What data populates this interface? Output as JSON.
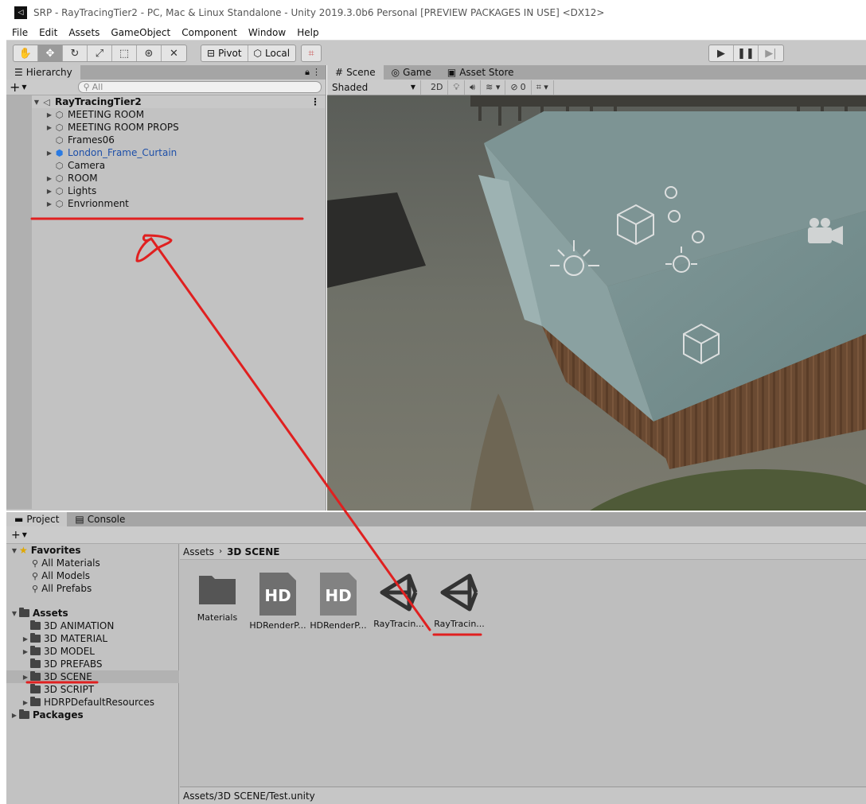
{
  "window": {
    "title": "SRP - RayTracingTier2 - PC, Mac & Linux Standalone - Unity 2019.3.0b6 Personal [PREVIEW PACKAGES IN USE] <DX12>"
  },
  "menu": [
    "File",
    "Edit",
    "Assets",
    "GameObject",
    "Component",
    "Window",
    "Help"
  ],
  "toolbar": {
    "pivot_label": "Pivot",
    "local_label": "Local"
  },
  "hierarchy": {
    "tab_label": "Hierarchy",
    "search_placeholder": "All",
    "root": "RayTracingTier2",
    "items": [
      {
        "label": "MEETING ROOM",
        "expandable": true
      },
      {
        "label": "MEETING ROOM PROPS",
        "expandable": true
      },
      {
        "label": "Frames06",
        "expandable": false
      },
      {
        "label": "London_Frame_Curtain",
        "expandable": true,
        "prefab": true
      },
      {
        "label": "Camera",
        "expandable": false
      },
      {
        "label": "ROOM",
        "expandable": true
      },
      {
        "label": "Lights",
        "expandable": true
      },
      {
        "label": "Envrionment",
        "expandable": true
      }
    ]
  },
  "scene": {
    "tabs": [
      "Scene",
      "Game",
      "Asset Store"
    ],
    "draw_mode": "Shaded",
    "mode_2d": "2D",
    "hidden_count": "0"
  },
  "project": {
    "tabs": [
      "Project",
      "Console"
    ],
    "favorites_label": "Favorites",
    "favorites": [
      "All Materials",
      "All Models",
      "All Prefabs"
    ],
    "assets_label": "Assets",
    "folders": [
      {
        "label": "3D ANIMATION",
        "expandable": false
      },
      {
        "label": "3D MATERIAL",
        "expandable": true
      },
      {
        "label": "3D MODEL",
        "expandable": true
      },
      {
        "label": "3D PREFABS",
        "expandable": false
      },
      {
        "label": "3D SCENE",
        "expandable": true,
        "selected": true
      },
      {
        "label": "3D SCRIPT",
        "expandable": false
      },
      {
        "label": "HDRPDefaultResources",
        "expandable": true
      }
    ],
    "packages_label": "Packages",
    "breadcrumb": {
      "root": "Assets",
      "current": "3D SCENE"
    },
    "asset_items": [
      {
        "label": "Materials",
        "icon": "folder-icon"
      },
      {
        "label": "HDRenderP...",
        "icon": "hd-asset-icon"
      },
      {
        "label": "HDRenderP...",
        "icon": "hd-asset-icon"
      },
      {
        "label": "RayTracin...",
        "icon": "unity-scene-icon"
      },
      {
        "label": "RayTracin...",
        "icon": "unity-scene-icon"
      }
    ],
    "status_path": "Assets/3D SCENE/Test.unity"
  },
  "annotation_color": "#e02020"
}
